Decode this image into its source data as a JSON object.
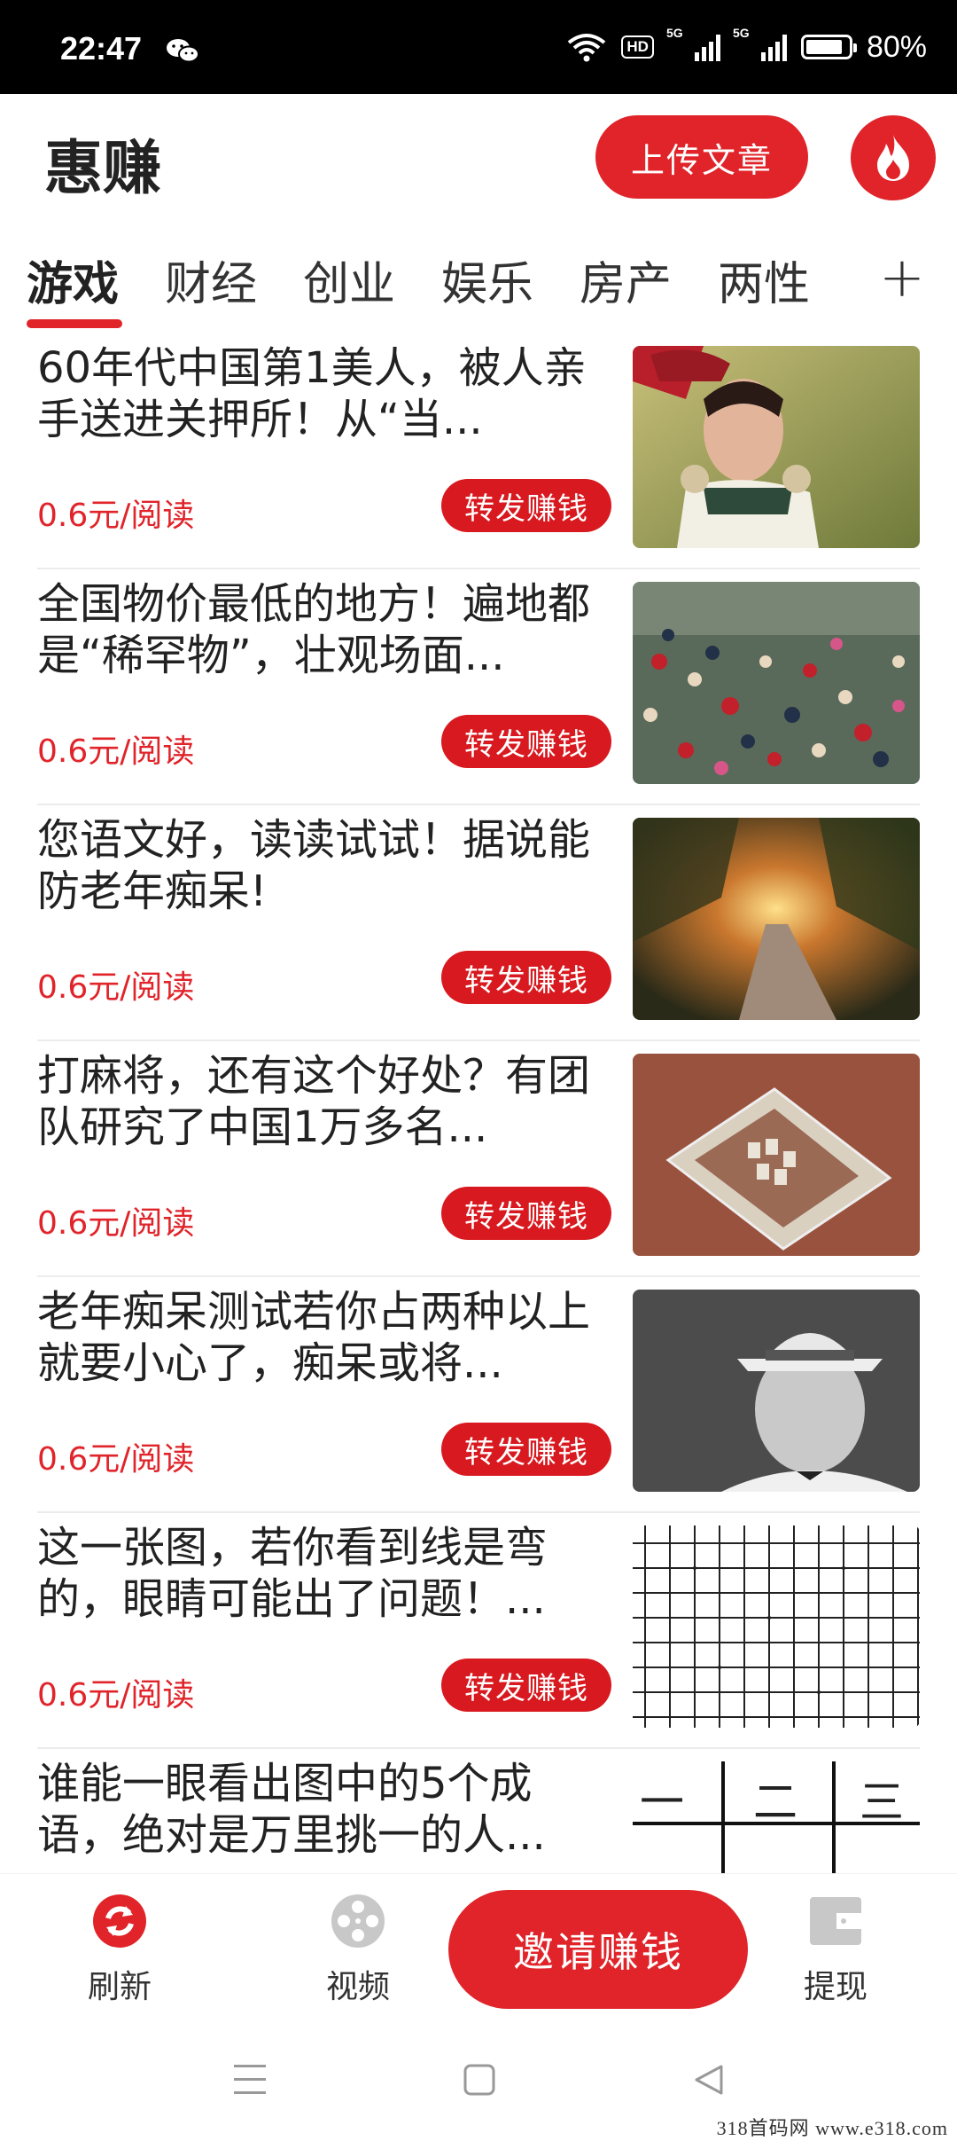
{
  "status_bar": {
    "time": "22:47",
    "battery": "80%",
    "hd_label": "HD",
    "signal_label": "5G"
  },
  "header": {
    "title": "惠赚",
    "upload_label": "上传文章"
  },
  "tabs": {
    "items": [
      "游戏",
      "财经",
      "创业",
      "娱乐",
      "房产",
      "两性"
    ],
    "active_index": 0,
    "add_label": "+"
  },
  "feed": {
    "items": [
      {
        "title": "60年代中国第1美人，被人亲手送进关押所！从“当...",
        "reward": "0.6元/阅读",
        "action": "转发赚钱"
      },
      {
        "title": "全国物价最低的地方！遍地都是“稀罕物”，壮观场面...",
        "reward": "0.6元/阅读",
        "action": "转发赚钱"
      },
      {
        "title": "您语文好，读读试试！据说能防老年痴呆!",
        "reward": "0.6元/阅读",
        "action": "转发赚钱"
      },
      {
        "title": "打麻将，还有这个好处？有团队研究了中国1万多名...",
        "reward": "0.6元/阅读",
        "action": "转发赚钱"
      },
      {
        "title": "老年痴呆测试若你占两种以上就要小心了，痴呆或将...",
        "reward": "0.6元/阅读",
        "action": "转发赚钱"
      },
      {
        "title": "这一张图，若你看到线是弯的，眼睛可能出了问题！...",
        "reward": "0.6元/阅读",
        "action": "转发赚钱"
      },
      {
        "title": "谁能一眼看出图中的5个成语，绝对是万里挑一的人..."
      }
    ],
    "last_thumb_chars": [
      "一",
      "二",
      "三"
    ]
  },
  "bottom_nav": {
    "refresh_label": "刷新",
    "video_label": "视频",
    "invite_label": "邀请赚钱",
    "withdraw_label": "提现"
  },
  "watermark": "318首码网  www.e318.com",
  "colors": {
    "accent": "#e0242a",
    "reward_text": "#e0242a",
    "status_bar_bg": "#000000"
  }
}
